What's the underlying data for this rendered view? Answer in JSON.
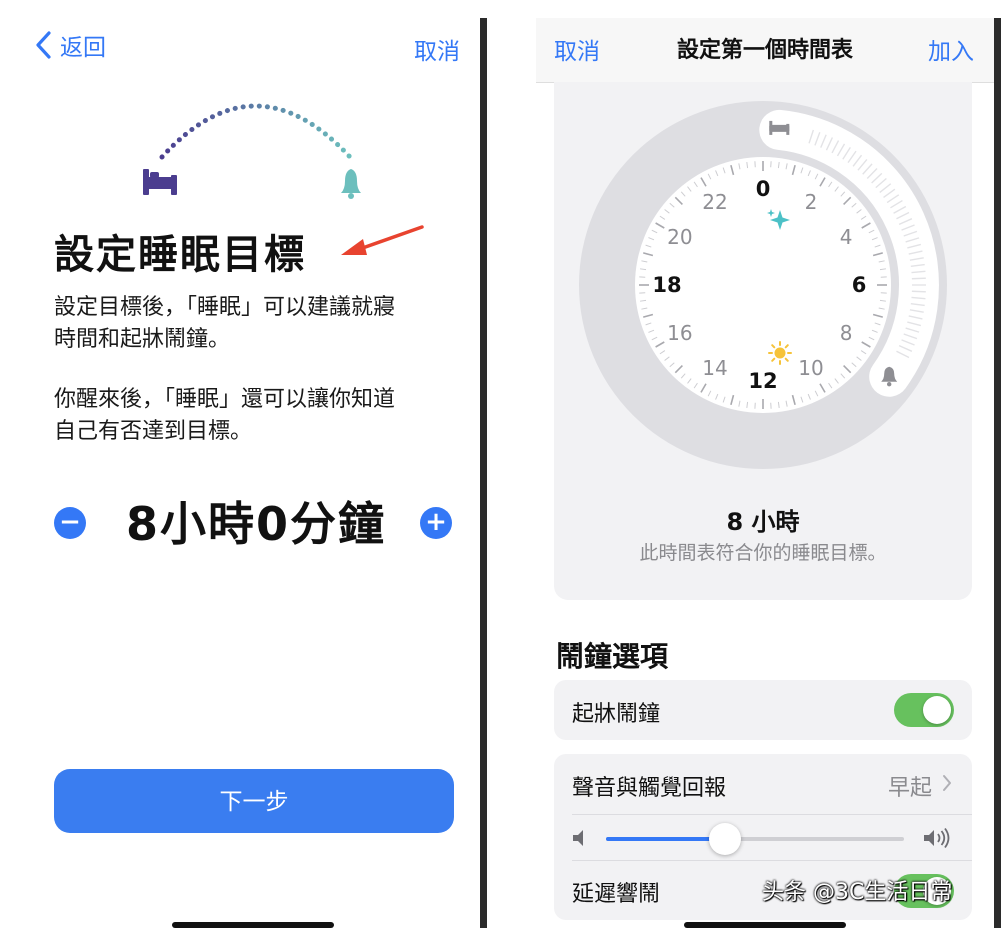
{
  "left": {
    "nav": {
      "back_label": "返回",
      "cancel_label": "取消"
    },
    "title": "設定睡眠目標",
    "paragraph_1_line_1": "設定目標後，「睡眠」可以建議就寢",
    "paragraph_1_line_2": "時間和起牀鬧鐘。",
    "paragraph_2_line_1": "你醒來後，「睡眠」還可以讓你知道",
    "paragraph_2_line_2": "自己有否達到目標。",
    "goal": {
      "duration": "8小時0分鐘",
      "minus": "−",
      "plus": "+"
    },
    "next_label": "下一步"
  },
  "right": {
    "nav": {
      "cancel_label": "取消",
      "title": "設定第一個時間表",
      "add_label": "加入"
    },
    "clock": {
      "hour_labels": [
        "0",
        "2",
        "4",
        "6",
        "8",
        "10",
        "12",
        "14",
        "16",
        "18",
        "20",
        "22"
      ],
      "bedtime_hour": 0.4,
      "wake_hour": 8.4
    },
    "duration_label": "8 小時",
    "goal_note": "此時間表符合你的睡眠目標。",
    "alarm_section_title": "鬧鐘選項",
    "wake_alarm_label": "起牀鬧鐘",
    "wake_alarm_on": true,
    "sound_label": "聲音與觸覺回報",
    "sound_value": "早起",
    "volume_level": 0.4,
    "snooze_label": "延遲響鬧",
    "snooze_on": true
  },
  "watermark": "头条 @3C生活日常",
  "colors": {
    "accent": "#3478f6",
    "toggle_on": "#67c15e",
    "arrow": "#e8432f",
    "bed_purple": "#4b3d8f",
    "bell_teal": "#6cbfbd"
  }
}
